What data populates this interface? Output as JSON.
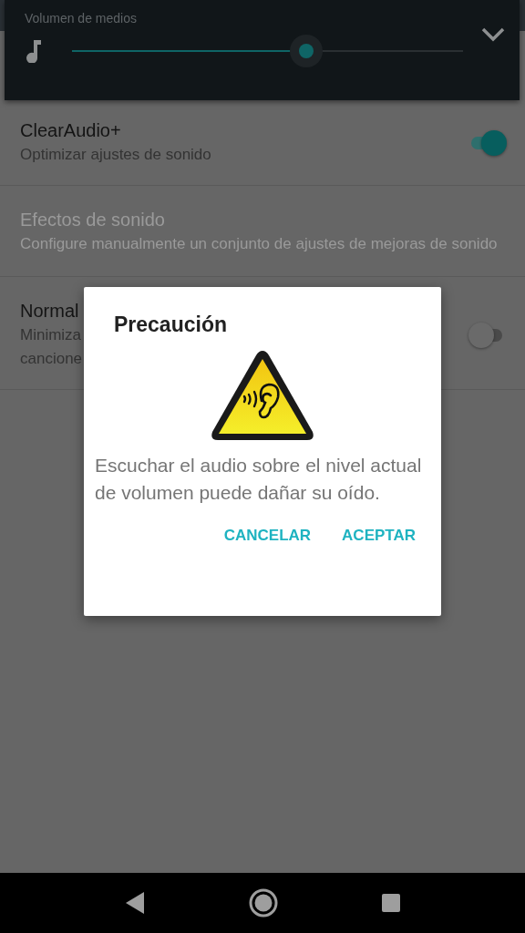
{
  "volume_panel": {
    "label": "Volumen de medios",
    "level": 0.6
  },
  "settings": [
    {
      "kind": "toggle",
      "title": "ClearAudio+",
      "subtitle": "Optimizar ajustes de sonido",
      "on": true,
      "disabled": false
    },
    {
      "kind": "plain",
      "title": "Efectos de sonido",
      "subtitle": "Configure manualmente un conjunto de ajustes de mejoras de sonido",
      "disabled": true
    },
    {
      "kind": "toggle",
      "title": "Normal",
      "subtitle_lines": [
        "Minimiza",
        "cancione"
      ],
      "on": false,
      "disabled": false
    }
  ],
  "dialog": {
    "title": "Precaución",
    "message": "Escuchar el audio sobre el nivel actual de volumen puede dañar su oído.",
    "buttons": [
      "CANCELAR",
      "ACEPTAR"
    ]
  }
}
